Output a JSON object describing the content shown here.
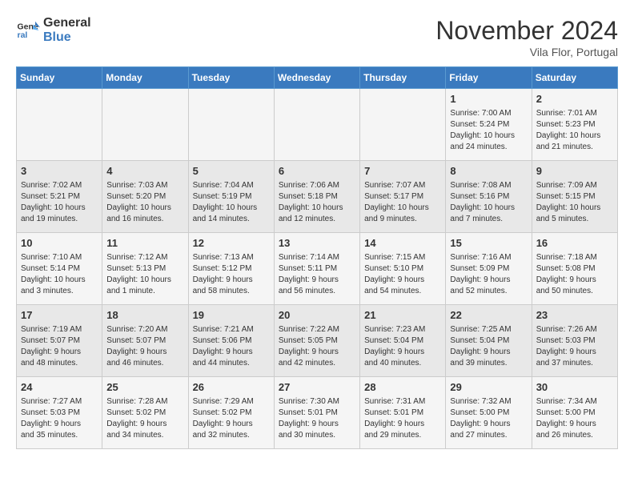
{
  "header": {
    "logo_line1": "General",
    "logo_line2": "Blue",
    "title": "November 2024",
    "subtitle": "Vila Flor, Portugal"
  },
  "weekdays": [
    "Sunday",
    "Monday",
    "Tuesday",
    "Wednesday",
    "Thursday",
    "Friday",
    "Saturday"
  ],
  "weeks": [
    [
      {
        "day": "",
        "content": ""
      },
      {
        "day": "",
        "content": ""
      },
      {
        "day": "",
        "content": ""
      },
      {
        "day": "",
        "content": ""
      },
      {
        "day": "",
        "content": ""
      },
      {
        "day": "1",
        "content": "Sunrise: 7:00 AM\nSunset: 5:24 PM\nDaylight: 10 hours\nand 24 minutes."
      },
      {
        "day": "2",
        "content": "Sunrise: 7:01 AM\nSunset: 5:23 PM\nDaylight: 10 hours\nand 21 minutes."
      }
    ],
    [
      {
        "day": "3",
        "content": "Sunrise: 7:02 AM\nSunset: 5:21 PM\nDaylight: 10 hours\nand 19 minutes."
      },
      {
        "day": "4",
        "content": "Sunrise: 7:03 AM\nSunset: 5:20 PM\nDaylight: 10 hours\nand 16 minutes."
      },
      {
        "day": "5",
        "content": "Sunrise: 7:04 AM\nSunset: 5:19 PM\nDaylight: 10 hours\nand 14 minutes."
      },
      {
        "day": "6",
        "content": "Sunrise: 7:06 AM\nSunset: 5:18 PM\nDaylight: 10 hours\nand 12 minutes."
      },
      {
        "day": "7",
        "content": "Sunrise: 7:07 AM\nSunset: 5:17 PM\nDaylight: 10 hours\nand 9 minutes."
      },
      {
        "day": "8",
        "content": "Sunrise: 7:08 AM\nSunset: 5:16 PM\nDaylight: 10 hours\nand 7 minutes."
      },
      {
        "day": "9",
        "content": "Sunrise: 7:09 AM\nSunset: 5:15 PM\nDaylight: 10 hours\nand 5 minutes."
      }
    ],
    [
      {
        "day": "10",
        "content": "Sunrise: 7:10 AM\nSunset: 5:14 PM\nDaylight: 10 hours\nand 3 minutes."
      },
      {
        "day": "11",
        "content": "Sunrise: 7:12 AM\nSunset: 5:13 PM\nDaylight: 10 hours\nand 1 minute."
      },
      {
        "day": "12",
        "content": "Sunrise: 7:13 AM\nSunset: 5:12 PM\nDaylight: 9 hours\nand 58 minutes."
      },
      {
        "day": "13",
        "content": "Sunrise: 7:14 AM\nSunset: 5:11 PM\nDaylight: 9 hours\nand 56 minutes."
      },
      {
        "day": "14",
        "content": "Sunrise: 7:15 AM\nSunset: 5:10 PM\nDaylight: 9 hours\nand 54 minutes."
      },
      {
        "day": "15",
        "content": "Sunrise: 7:16 AM\nSunset: 5:09 PM\nDaylight: 9 hours\nand 52 minutes."
      },
      {
        "day": "16",
        "content": "Sunrise: 7:18 AM\nSunset: 5:08 PM\nDaylight: 9 hours\nand 50 minutes."
      }
    ],
    [
      {
        "day": "17",
        "content": "Sunrise: 7:19 AM\nSunset: 5:07 PM\nDaylight: 9 hours\nand 48 minutes."
      },
      {
        "day": "18",
        "content": "Sunrise: 7:20 AM\nSunset: 5:07 PM\nDaylight: 9 hours\nand 46 minutes."
      },
      {
        "day": "19",
        "content": "Sunrise: 7:21 AM\nSunset: 5:06 PM\nDaylight: 9 hours\nand 44 minutes."
      },
      {
        "day": "20",
        "content": "Sunrise: 7:22 AM\nSunset: 5:05 PM\nDaylight: 9 hours\nand 42 minutes."
      },
      {
        "day": "21",
        "content": "Sunrise: 7:23 AM\nSunset: 5:04 PM\nDaylight: 9 hours\nand 40 minutes."
      },
      {
        "day": "22",
        "content": "Sunrise: 7:25 AM\nSunset: 5:04 PM\nDaylight: 9 hours\nand 39 minutes."
      },
      {
        "day": "23",
        "content": "Sunrise: 7:26 AM\nSunset: 5:03 PM\nDaylight: 9 hours\nand 37 minutes."
      }
    ],
    [
      {
        "day": "24",
        "content": "Sunrise: 7:27 AM\nSunset: 5:03 PM\nDaylight: 9 hours\nand 35 minutes."
      },
      {
        "day": "25",
        "content": "Sunrise: 7:28 AM\nSunset: 5:02 PM\nDaylight: 9 hours\nand 34 minutes."
      },
      {
        "day": "26",
        "content": "Sunrise: 7:29 AM\nSunset: 5:02 PM\nDaylight: 9 hours\nand 32 minutes."
      },
      {
        "day": "27",
        "content": "Sunrise: 7:30 AM\nSunset: 5:01 PM\nDaylight: 9 hours\nand 30 minutes."
      },
      {
        "day": "28",
        "content": "Sunrise: 7:31 AM\nSunset: 5:01 PM\nDaylight: 9 hours\nand 29 minutes."
      },
      {
        "day": "29",
        "content": "Sunrise: 7:32 AM\nSunset: 5:00 PM\nDaylight: 9 hours\nand 27 minutes."
      },
      {
        "day": "30",
        "content": "Sunrise: 7:34 AM\nSunset: 5:00 PM\nDaylight: 9 hours\nand 26 minutes."
      }
    ]
  ]
}
